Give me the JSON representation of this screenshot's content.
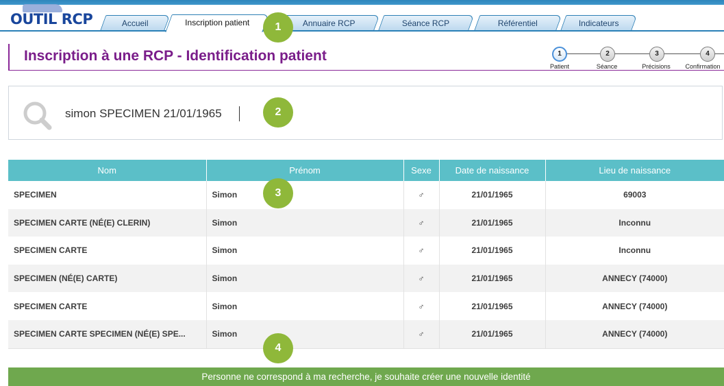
{
  "app": {
    "logo_text": "OUTIL RCP",
    "colors": {
      "brand_blue": "#2a80b7",
      "title_purple": "#7a1d8a",
      "table_header": "#5bbfc8",
      "action_green": "#6fa84e",
      "badge_green": "#8fb83a"
    }
  },
  "nav": {
    "tabs": [
      {
        "label": "Accueil",
        "active": false
      },
      {
        "label": "Inscription patient",
        "active": true
      },
      {
        "label": "Annuaire RCP",
        "active": false
      },
      {
        "label": "Séance RCP",
        "active": false
      },
      {
        "label": "Référentiel",
        "active": false
      },
      {
        "label": "Indicateurs",
        "active": false
      }
    ]
  },
  "header": {
    "title": "Inscription à une RCP - Identification patient"
  },
  "stepper": {
    "current": 1,
    "steps": [
      {
        "number": "1",
        "label": "Patient"
      },
      {
        "number": "2",
        "label": "Séance"
      },
      {
        "number": "3",
        "label": "Précisions"
      },
      {
        "number": "4",
        "label": "Confirmation"
      }
    ]
  },
  "search": {
    "icon": "search-icon",
    "value": "simon SPECIMEN 21/01/1965"
  },
  "table": {
    "columns": [
      "Nom",
      "Prénom",
      "Sexe",
      "Date de naissance",
      "Lieu de naissance"
    ],
    "rows": [
      {
        "nom": "SPECIMEN",
        "prenom": "Simon",
        "sexe": "♂",
        "date": "21/01/1965",
        "lieu": "69003"
      },
      {
        "nom": "SPECIMEN CARTE (NÉ(E) CLERIN)",
        "prenom": "Simon",
        "sexe": "♂",
        "date": "21/01/1965",
        "lieu": "Inconnu"
      },
      {
        "nom": "SPECIMEN CARTE",
        "prenom": "Simon",
        "sexe": "♂",
        "date": "21/01/1965",
        "lieu": "Inconnu"
      },
      {
        "nom": "SPECIMEN (NÉ(E) CARTE)",
        "prenom": "Simon",
        "sexe": "♂",
        "date": "21/01/1965",
        "lieu": "ANNECY (74000)"
      },
      {
        "nom": "SPECIMEN CARTE",
        "prenom": "Simon",
        "sexe": "♂",
        "date": "21/01/1965",
        "lieu": "ANNECY (74000)"
      },
      {
        "nom": "SPECIMEN CARTE SPECIMEN (NÉ(E) SPE...",
        "prenom": "Simon",
        "sexe": "♂",
        "date": "21/01/1965",
        "lieu": "ANNECY (74000)"
      }
    ]
  },
  "actions": {
    "create_label": "Personne ne correspond à ma recherche, je souhaite créer une nouvelle identité"
  },
  "callouts": [
    "1",
    "2",
    "3",
    "4"
  ]
}
